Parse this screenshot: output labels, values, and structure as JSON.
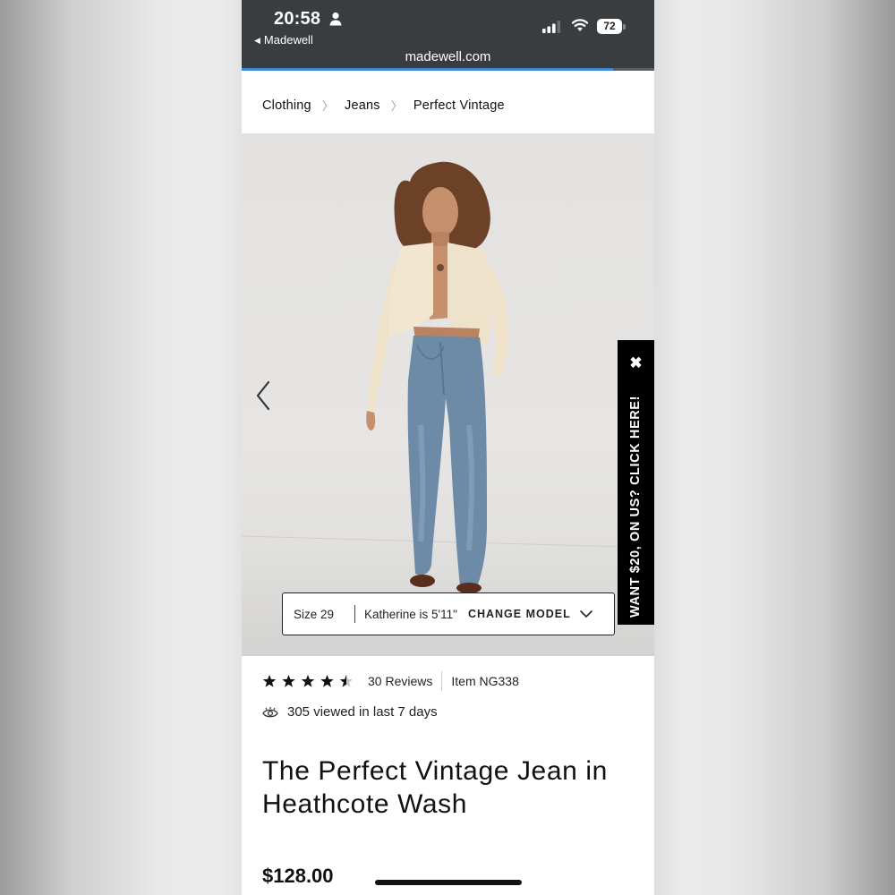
{
  "status_bar": {
    "time": "20:58",
    "back_app": "Madewell",
    "battery": "72",
    "url": "madewell.com",
    "page_load_progress": 0.9
  },
  "breadcrumb": [
    "Clothing",
    "Jeans",
    "Perfect Vintage"
  ],
  "hero": {
    "model_bar": {
      "size": "Size 29",
      "model_note": "Katherine is 5'11\"",
      "change_label": "CHANGE MODEL"
    }
  },
  "promo": {
    "text": "WANT $20, ON US? CLICK HERE!",
    "close_glyph": "✖"
  },
  "product": {
    "rating": 4.5,
    "reviews": "30 Reviews",
    "item": "Item NG338",
    "viewed": "305 viewed in last 7 days",
    "title": "The Perfect Vintage Jean in Heathcote Wash",
    "price": "$128.00"
  },
  "colors": {
    "status_bar_bg": "#3a3d40",
    "progress": "#3d86d9",
    "promo_bg": "#000000",
    "text": "#111111"
  }
}
